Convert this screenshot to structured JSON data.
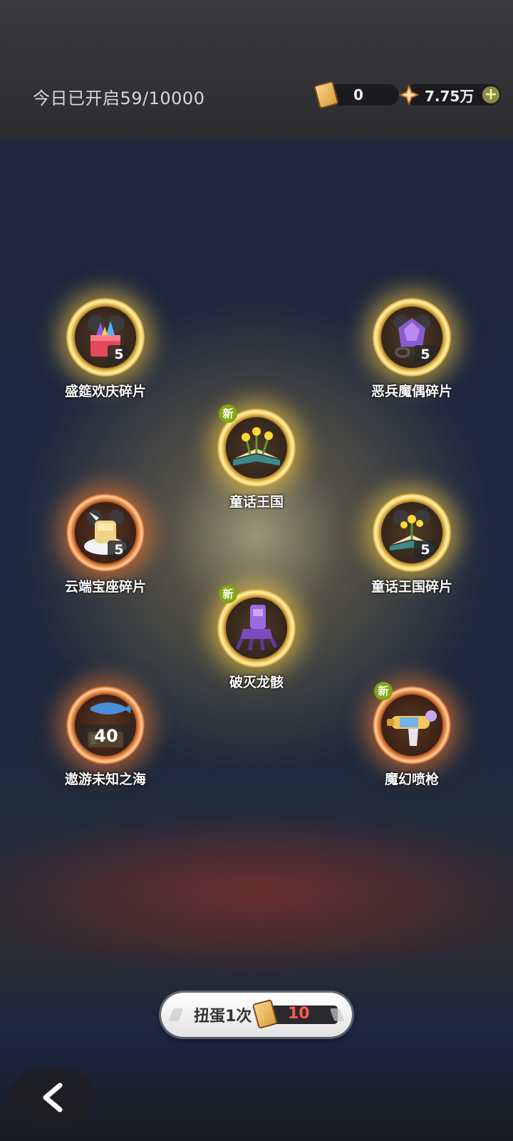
{
  "header": {
    "daily_opened": "今日已开启59/10000",
    "resources": [
      {
        "icon": "ticket-icon",
        "value": "0"
      },
      {
        "icon": "star-crystal-icon",
        "value": "7.75万",
        "add": "+"
      }
    ]
  },
  "items": [
    {
      "name": "盛筵欢庆碎片",
      "count": "5",
      "new": false,
      "frame": "gold"
    },
    {
      "name": "恶兵魔偶碎片",
      "count": "5",
      "new": false,
      "frame": "gold"
    },
    {
      "name": "童话王国",
      "count": "",
      "new": true,
      "new_label": "新",
      "frame": "gold"
    },
    {
      "name": "云端宝座碎片",
      "count": "5",
      "new": false,
      "frame": "orange"
    },
    {
      "name": "童话王国碎片",
      "count": "5",
      "new": false,
      "frame": "gold"
    },
    {
      "name": "破灭龙骸",
      "count": "",
      "new": true,
      "new_label": "新",
      "frame": "gold"
    },
    {
      "name": "遨游未知之海",
      "count": "40",
      "new": false,
      "frame": "orange"
    },
    {
      "name": "魔幻喷枪",
      "count": "",
      "new": true,
      "new_label": "新",
      "frame": "orange"
    }
  ],
  "spin_button": {
    "label": "扭蛋1次",
    "cost": "10"
  },
  "nav": {
    "back": "back-icon"
  }
}
